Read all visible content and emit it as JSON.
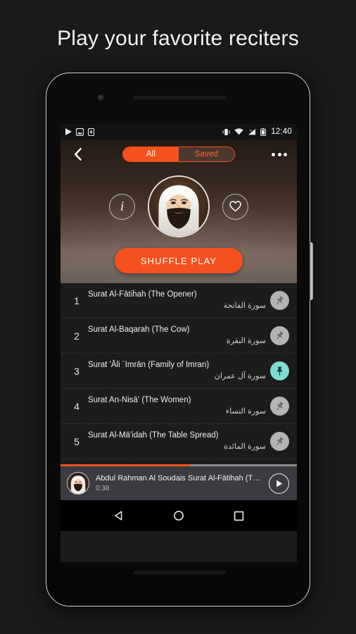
{
  "promo": {
    "headline": "Play your favorite reciters"
  },
  "status_bar": {
    "time": "12:40",
    "left_icons": [
      "play-icon",
      "image-icon",
      "download-icon"
    ],
    "right_icons": [
      "vibrate-icon",
      "wifi-icon",
      "signal-icon",
      "battery-icon"
    ]
  },
  "header": {
    "back_icon": "back-chevron-icon",
    "overflow_icon": "overflow-menu-icon",
    "tabs": [
      {
        "label": "All",
        "active": true
      },
      {
        "label": "Saved",
        "active": false
      }
    ],
    "info_icon": "info-icon",
    "favorite_icon": "heart-icon",
    "avatar": "artist-avatar",
    "shuffle_label": "SHUFFLE PLAY"
  },
  "tracks": [
    {
      "num": "1",
      "title": "Surat Al-Fātiĥah (The Opener)",
      "arabic": "سورة الفاتحة",
      "pinned": false
    },
    {
      "num": "2",
      "title": "Surat Al-Baqarah (The Cow)",
      "arabic": "سورة البقرة",
      "pinned": false
    },
    {
      "num": "3",
      "title": "Surat 'Āli `Imrān (Family of Imran)",
      "arabic": "سورة آل عمران",
      "pinned": true
    },
    {
      "num": "4",
      "title": "Surat An-Nisā' (The Women)",
      "arabic": "سورة النساء",
      "pinned": false
    },
    {
      "num": "5",
      "title": "Surat Al-Mā'idah (The Table Spread)",
      "arabic": "سورة المائدة",
      "pinned": false
    }
  ],
  "player": {
    "progress_percent": 55,
    "title": "Abdul Rahman Al Soudais Surat Al-Fātiĥah (The…",
    "time": "0:38",
    "play_icon": "play-icon"
  },
  "nav_bar": {
    "back_icon": "nav-back-icon",
    "home_icon": "nav-home-icon",
    "recents_icon": "nav-recents-icon"
  },
  "colors": {
    "accent": "#f4511e",
    "pin_active": "#7fdcd0",
    "pin_inactive": "#b4b4b4"
  }
}
